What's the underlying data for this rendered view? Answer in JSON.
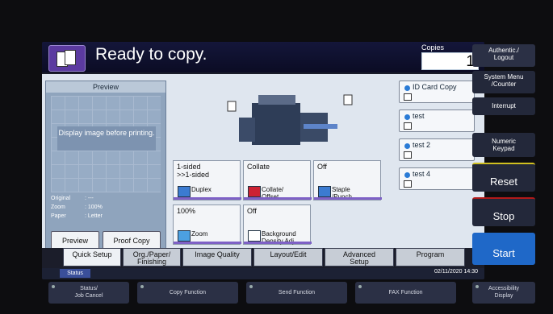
{
  "header": {
    "title": "Ready to copy.",
    "copies_label": "Copies",
    "copies_value": "1"
  },
  "preview": {
    "title": "Preview",
    "message": "Display image before printing.",
    "info": [
      {
        "k": "Original",
        "v": ": ---"
      },
      {
        "k": "Zoom",
        "v": ": 100%"
      },
      {
        "k": "Paper",
        "v": ": Letter"
      }
    ],
    "preview_button": "Preview",
    "proof_button": "Proof Copy"
  },
  "tiles": {
    "duplex": {
      "value": "1-sided\n>>1-sided",
      "label": "Duplex"
    },
    "collate": {
      "value": "Collate",
      "label": "Collate/\nOffset"
    },
    "staple": {
      "value": "Off",
      "label": "Staple\n/Punch"
    },
    "zoom": {
      "value": "100%",
      "label": "Zoom"
    },
    "density": {
      "value": "Off",
      "label": "Background\nDensity Adj."
    }
  },
  "shortcuts": [
    "ID Card Copy",
    "test",
    "test 2",
    "test 4"
  ],
  "tabs": [
    "Quick Setup",
    "Org./Paper/\nFinishing",
    "Image Quality",
    "Layout/Edit",
    "Advanced\nSetup",
    "Program"
  ],
  "status": {
    "label": "Status",
    "datetime": "02/11/2020 14:30"
  },
  "function_keys": [
    "Status/\nJob Cancel",
    "Copy Function",
    "Send Function",
    "FAX Function",
    "Accessibility\nDisplay"
  ],
  "right_keys": {
    "authentic": "Authentic./\nLogout",
    "system_menu": "System Menu\n/Counter",
    "interrupt": "Interrupt",
    "numeric": "Numeric\nKeypad",
    "reset": "Reset",
    "stop": "Stop",
    "start": "Start"
  },
  "colors": {
    "accent": "#7e61c6",
    "start": "#1f68c8",
    "stop": "#b21a1a"
  }
}
